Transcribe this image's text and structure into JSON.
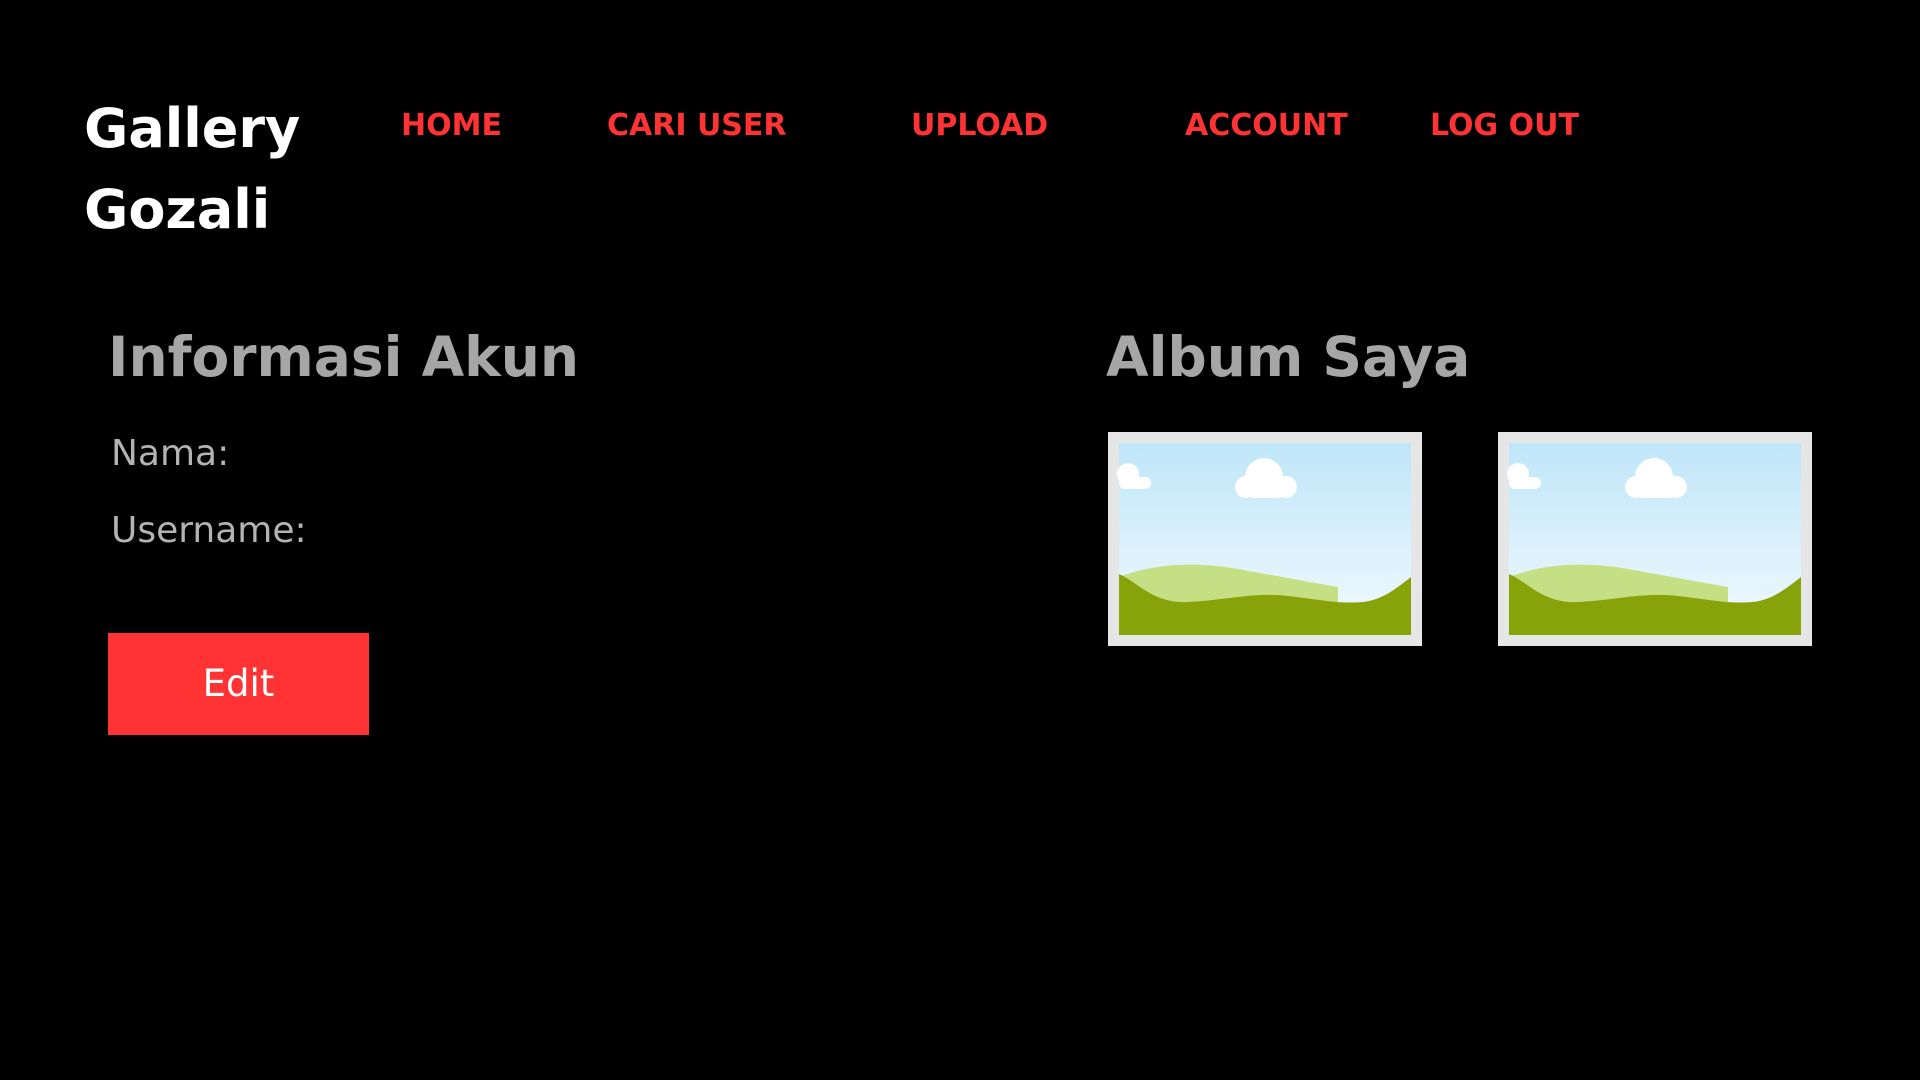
{
  "brand": {
    "line1": "Gallery",
    "line2": "Gozali"
  },
  "nav": {
    "home": "HOME",
    "cari_user": "CARI USER",
    "upload": "UPLOAD",
    "account": "ACCOUNT",
    "logout": "LOG OUT"
  },
  "account_info": {
    "title": "Informasi Akun",
    "nama_label": "Nama:",
    "username_label": "Username:",
    "edit_label": "Edit"
  },
  "album": {
    "title": "Album Saya",
    "items": [
      {
        "icon": "image-placeholder-icon"
      },
      {
        "icon": "image-placeholder-icon"
      }
    ]
  },
  "colors": {
    "background": "#000000",
    "accent": "#ff3333",
    "brand_text": "#ffffff",
    "heading": "#a6a6a6",
    "label": "#b3b3b3"
  }
}
